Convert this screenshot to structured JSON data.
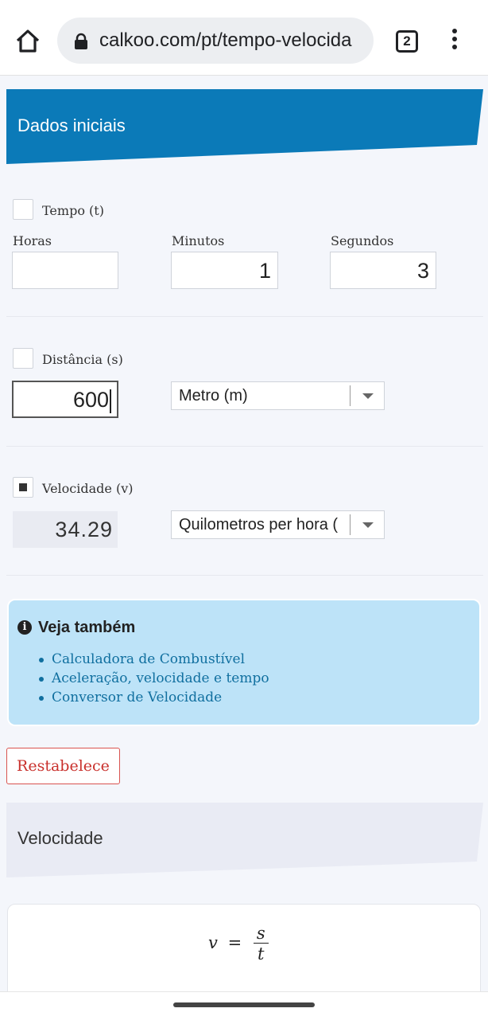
{
  "browser": {
    "url": "calkoo.com/pt/tempo-velocida",
    "tab_count": "2",
    "home_icon": "home-icon",
    "lock_icon": "lock-icon",
    "menu_icon": "more-vert-icon"
  },
  "section_header": {
    "title": "Dados iniciais",
    "color": "#0b7ab8"
  },
  "tempo": {
    "label": "Tempo (t)",
    "checked": false,
    "horas": {
      "label": "Horas",
      "value": ""
    },
    "minutos": {
      "label": "Minutos",
      "value": "1"
    },
    "segundos": {
      "label": "Segundos",
      "value": "3"
    }
  },
  "distancia": {
    "label": "Distância (s)",
    "checked": false,
    "value": "600",
    "unit": "Metro (m)"
  },
  "velocidade": {
    "label": "Velocidade (v)",
    "checked": true,
    "value": "34.29",
    "unit": "Quilometros per hora ("
  },
  "see_also": {
    "title": "Veja também",
    "links": [
      "Calculadora de Combustível",
      "Aceleração, velocidade e tempo",
      "Conversor de Velocidade"
    ]
  },
  "reset_button": "Restabelece",
  "result_header": {
    "title": "Velocidade"
  },
  "formula": {
    "lhs": "v",
    "eq": "=",
    "numerator": "s",
    "denominator": "t"
  }
}
